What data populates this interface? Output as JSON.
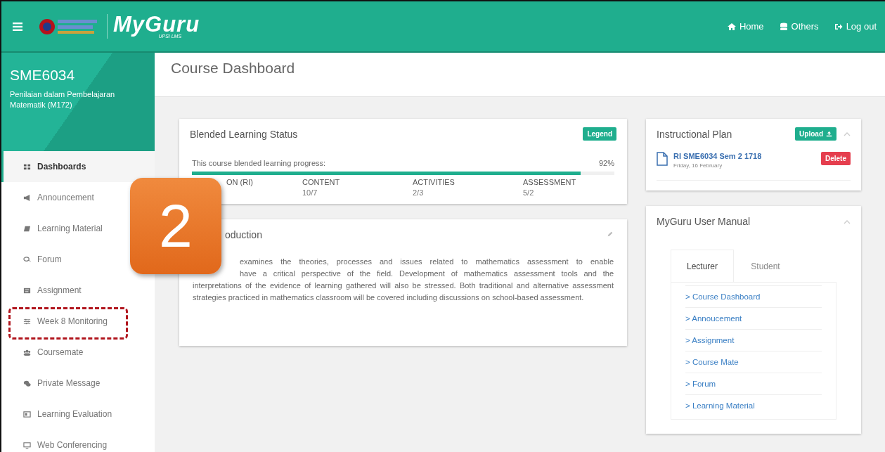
{
  "topbar": {
    "brand": "MyGuru",
    "brand_sub": "UPSI LMS",
    "nav": [
      {
        "label": "Home"
      },
      {
        "label": "Others"
      },
      {
        "label": "Log out"
      }
    ]
  },
  "course": {
    "code": "SME6034",
    "name": "Penilaian dalam Pembelajaran Matematik (M172)"
  },
  "sidebar": {
    "items": [
      {
        "label": "Dashboards",
        "selected": true,
        "highlighted": false
      },
      {
        "label": "Announcement",
        "selected": false,
        "highlighted": false
      },
      {
        "label": "Learning Material",
        "selected": false,
        "highlighted": false
      },
      {
        "label": "Forum",
        "selected": false,
        "highlighted": false
      },
      {
        "label": "Assignment",
        "selected": false,
        "highlighted": false
      },
      {
        "label": "Week 8 Monitoring",
        "selected": false,
        "highlighted": true
      },
      {
        "label": "Coursemate",
        "selected": false,
        "highlighted": false
      },
      {
        "label": "Private Message",
        "selected": false,
        "highlighted": false
      },
      {
        "label": "Learning Evaluation",
        "selected": false,
        "highlighted": false
      },
      {
        "label": "Web Conferencing",
        "selected": false,
        "highlighted": false
      }
    ]
  },
  "page_title": "Course Dashboard",
  "blended": {
    "title": "Blended Learning Status",
    "legend_button": "Legend",
    "progress_label": "This course blended learning progress:",
    "reading": "92%",
    "level": 0.92,
    "stats": [
      {
        "label": "ON (RI)"
      },
      {
        "label": "CONTENT",
        "value": "10/7"
      },
      {
        "label": "ACTIVITIES",
        "value": "2/3"
      },
      {
        "label": "ASSESSMENT",
        "value": "5/2"
      }
    ]
  },
  "intro": {
    "title": "oduction",
    "lines": [
      "examines the theories, processes and issues related to mathematics assessment to enable",
      "have a critical perspective of the field. Development of mathematics assessment tools and the",
      "interpretations of the evidence of learning gathered will also be stressed. Both traditional and alternative assessment strategies practiced in mathematics classroom will be covered including discussions on school-based assessment."
    ]
  },
  "instructional_plan": {
    "title": "Instructional Plan",
    "upload_button": "Upload",
    "file": {
      "name": "RI SME6034 Sem 2 1718",
      "date": "Friday, 16 February",
      "delete_button": "Delete"
    }
  },
  "manual": {
    "title": "MyGuru User Manual",
    "tabs": [
      {
        "label": "Lecturer",
        "selected": true
      },
      {
        "label": "Student",
        "selected": false
      }
    ],
    "links": [
      "> Course Dashboard",
      "> Annoucement",
      "> Assignment",
      "> Course Mate",
      "> Forum",
      "> Learning Material"
    ]
  },
  "callout": {
    "label": "2"
  }
}
